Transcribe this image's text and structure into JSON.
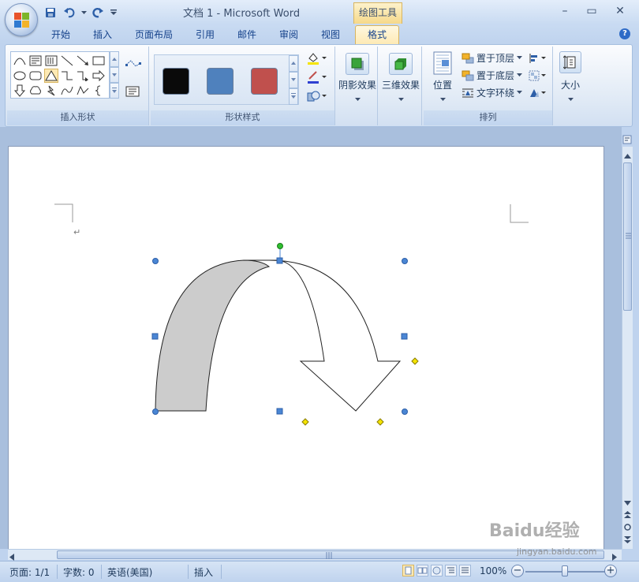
{
  "window": {
    "title": "文档 1 - Microsoft Word",
    "context_tab_group": "绘图工具",
    "controls": {
      "minimize": "–",
      "restore": "▭",
      "close": "✕"
    }
  },
  "quick_access": {
    "icons": [
      "save-icon",
      "undo-icon",
      "redo-icon",
      "customize-icon"
    ]
  },
  "tabs": [
    {
      "label": "开始"
    },
    {
      "label": "插入"
    },
    {
      "label": "页面布局"
    },
    {
      "label": "引用"
    },
    {
      "label": "邮件"
    },
    {
      "label": "审阅"
    },
    {
      "label": "视图"
    }
  ],
  "active_tab": "格式",
  "help_label": "?",
  "ribbon": {
    "insert_shapes": {
      "group_label": "插入形状"
    },
    "shape_styles": {
      "group_label": "形状样式",
      "swatches": [
        {
          "name": "black",
          "color": "#0a0a0a"
        },
        {
          "name": "blue",
          "color": "#4f81bd"
        },
        {
          "name": "red",
          "color": "#c0504d"
        }
      ]
    },
    "shadow": {
      "label": "阴影效果"
    },
    "three_d": {
      "label": "三维效果"
    },
    "arrange": {
      "group_label": "排列",
      "position_label": "位置",
      "bring_front": "置于顶层",
      "send_back": "置于底层",
      "text_wrap": "文字环绕"
    },
    "size": {
      "label": "大小"
    }
  },
  "status": {
    "page": "页面: 1/1",
    "words": "字数: 0",
    "language": "英语(美国)",
    "mode": "插入",
    "zoom": "100%",
    "zoom_out": "−",
    "zoom_in": "+"
  },
  "watermark": {
    "text": "Baidu经验",
    "url": "jingyan.baidu.com"
  },
  "colors": {
    "arrow_fill_shade": "#cccccc",
    "handle_blue": "#4a86d4",
    "handle_green": "#2fbf2f",
    "handle_yellow": "#f5e400"
  }
}
